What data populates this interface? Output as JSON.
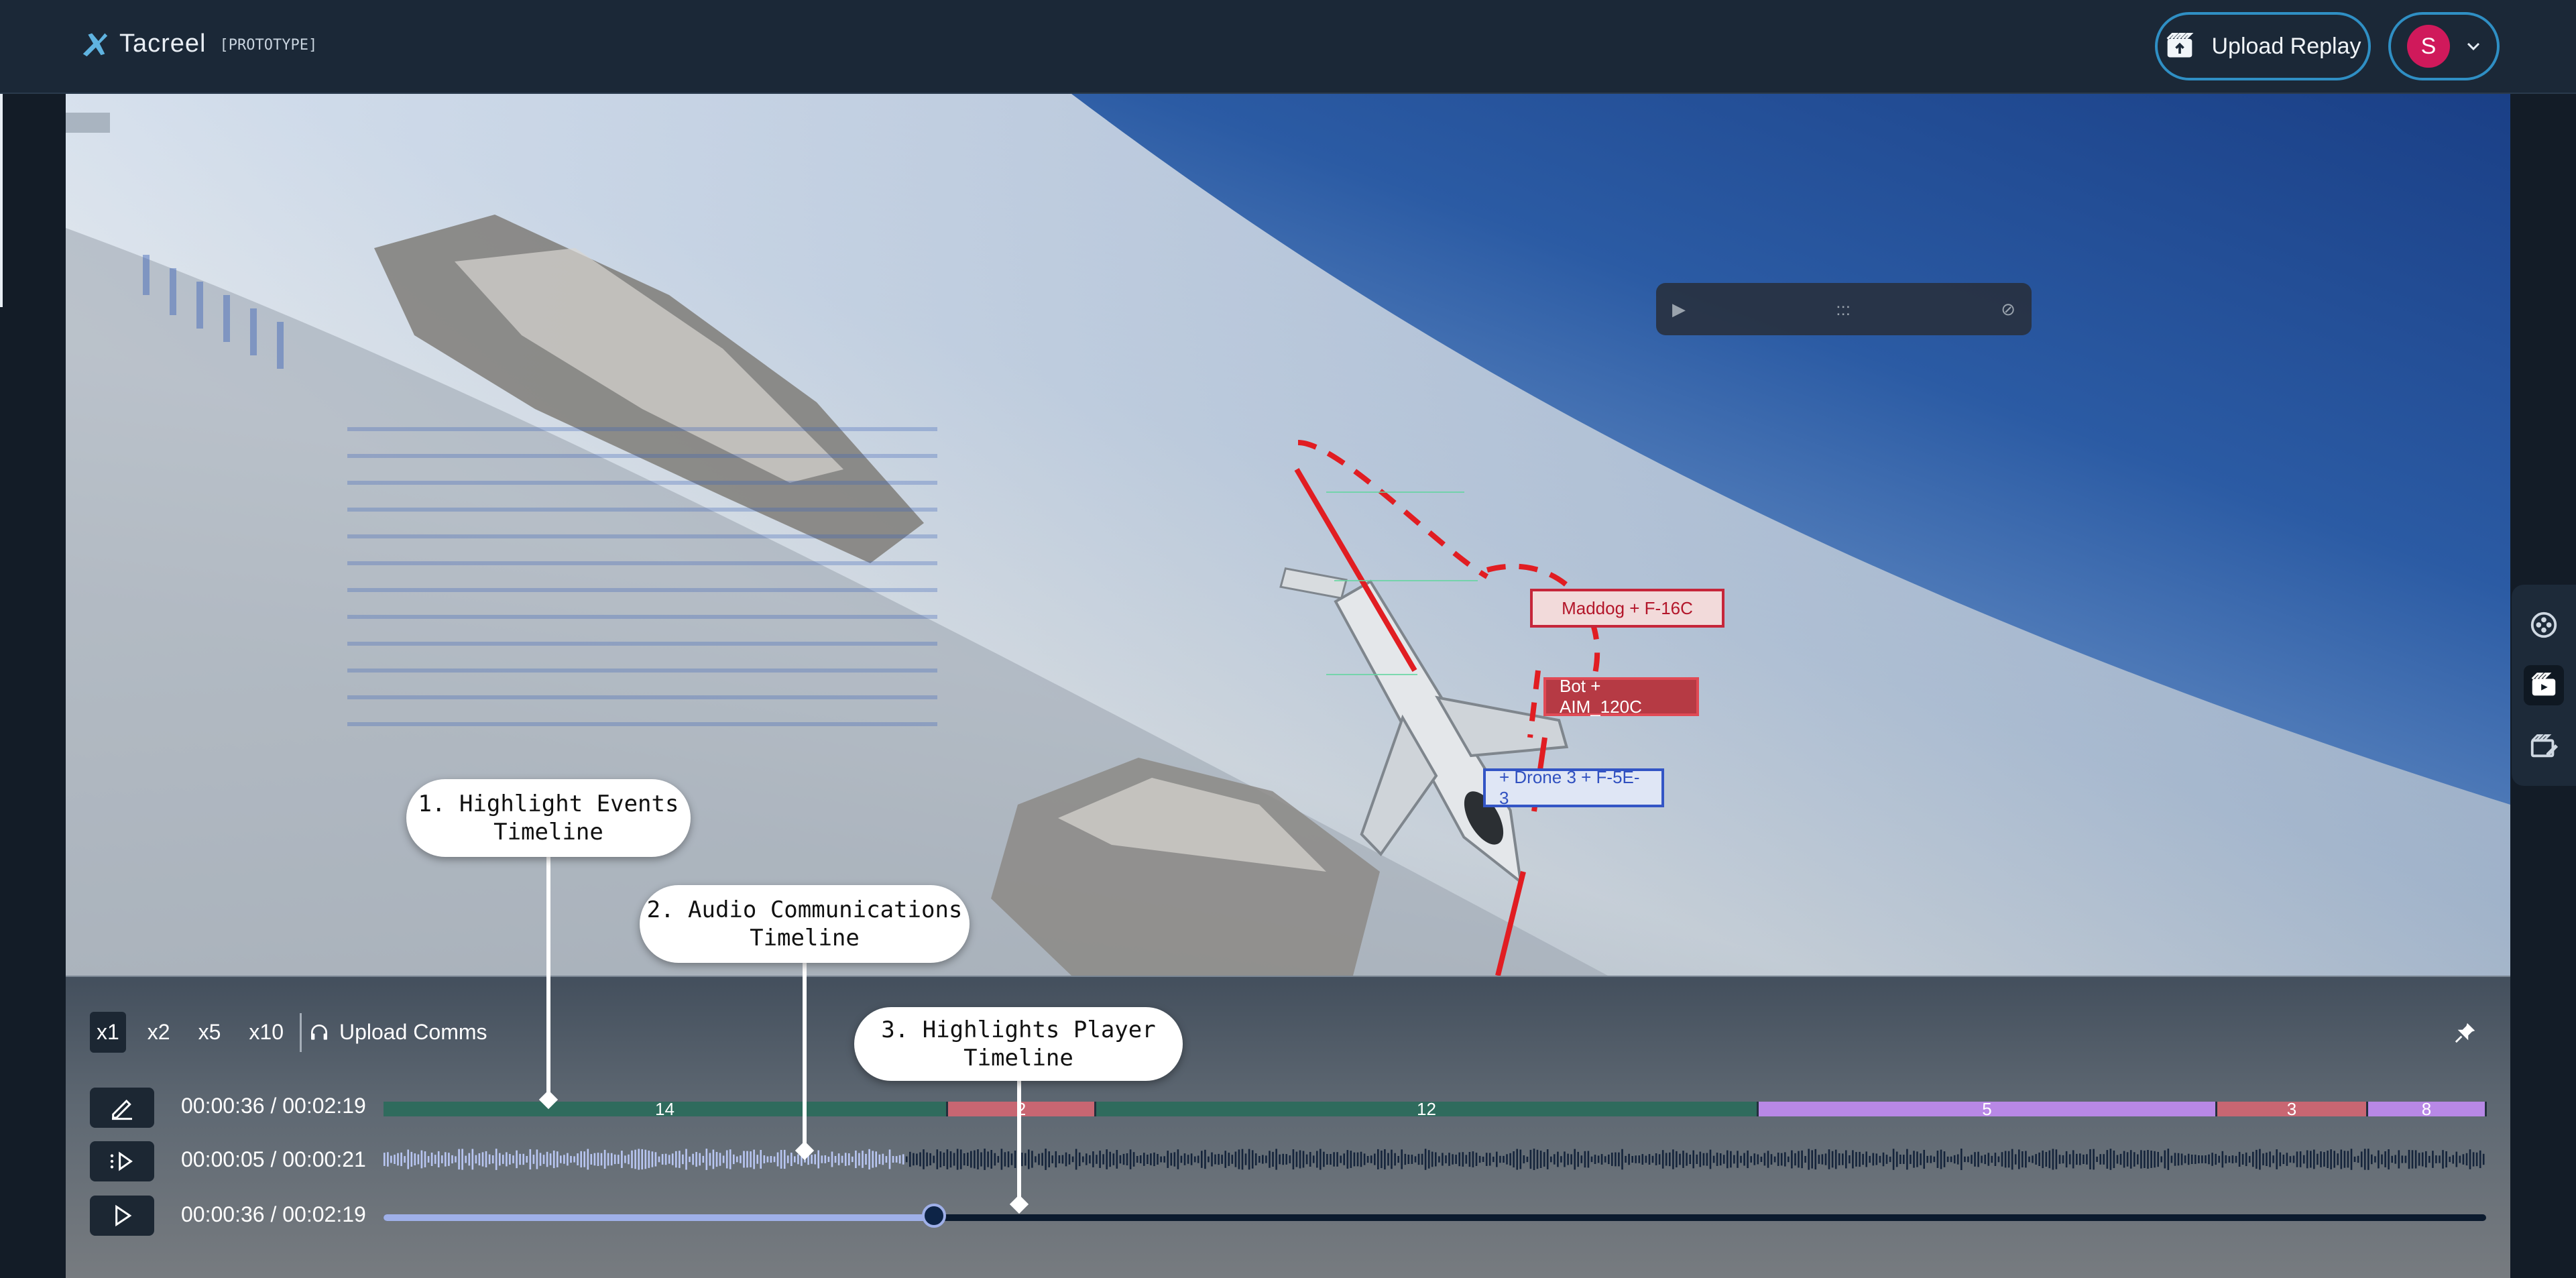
{
  "header": {
    "app_name": "Tacreel",
    "tag": "[PROTOTYPE]",
    "upload_replay_label": "Upload Replay",
    "avatar_initial": "S"
  },
  "viewport": {
    "labels": [
      {
        "text": "Maddog + F-16C",
        "color": "#c6263a"
      },
      {
        "text": "Bot + AIM_120C",
        "color": "#b63a44"
      },
      {
        "text": "+ Drone 3 + F-5E-3",
        "color": "#3355c5"
      }
    ],
    "float_bar": {
      "dots": ":::"
    }
  },
  "callouts": {
    "events": "1. Highlight Events Timeline",
    "audio": "2. Audio Communications Timeline",
    "player": "3. Highlights Player Timeline"
  },
  "controls": {
    "speeds": [
      "x1",
      "x2",
      "x5",
      "x10"
    ],
    "active_speed": "x1",
    "upload_comms_label": "Upload Comms",
    "events_time": "00:00:36 / 00:02:19",
    "audio_time": "00:00:05 / 00:00:21",
    "player_time": "00:00:36 / 00:02:19",
    "event_segments": [
      {
        "label": "14",
        "fraction": 0.2684,
        "color": "#2f6b5d"
      },
      {
        "label": "2",
        "fraction": 0.0704,
        "color": "#c86672"
      },
      {
        "label": "12",
        "fraction": 0.3149,
        "color": "#2f6b5d"
      },
      {
        "label": "5",
        "fraction": 0.2181,
        "color": "#b888e6"
      },
      {
        "label": "3",
        "fraction": 0.0716,
        "color": "#c86672"
      },
      {
        "label": "8",
        "fraction": 0.0566,
        "color": "#b888e6"
      }
    ],
    "audio_progress": 0.2477,
    "player_progress": 0.2619
  },
  "colors": {
    "accent": "#2f8fc4",
    "avatar": "#d0195b",
    "player_fill": "#9fb0e9"
  }
}
